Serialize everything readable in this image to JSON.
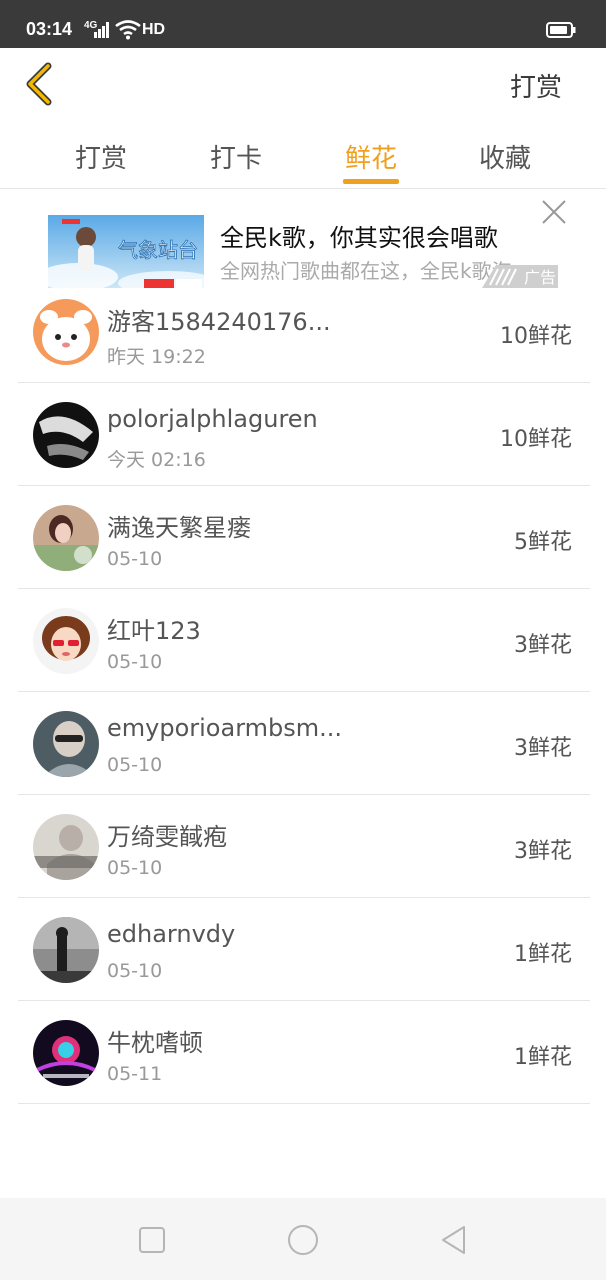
{
  "status": {
    "time": "03:14",
    "signal_label": "4G",
    "hd_label": "HD"
  },
  "header": {
    "action_label": "打赏"
  },
  "tabs": [
    {
      "label": "打赏"
    },
    {
      "label": "打卡"
    },
    {
      "label": "鲜花"
    },
    {
      "label": "收藏"
    }
  ],
  "ad": {
    "image_text": "气象站台",
    "title": "全民k歌，你其实很会唱歌",
    "description": "全网热门歌曲都在这，全民k歌海",
    "tag": "广告"
  },
  "list": [
    {
      "name": "游客1584240176...",
      "time": "昨天 19:22",
      "amount": "10鲜花"
    },
    {
      "name": "polorjalphlaguren",
      "time": "今天 02:16",
      "amount": "10鲜花"
    },
    {
      "name": "满逸天繁星瘘",
      "time": "05-10",
      "amount": "5鲜花"
    },
    {
      "name": "红叶123",
      "time": "05-10",
      "amount": "3鲜花"
    },
    {
      "name": "emyporioarmbsm...",
      "time": "05-10",
      "amount": "3鲜花"
    },
    {
      "name": "万绮雯馘疱",
      "time": "05-10",
      "amount": "3鲜花"
    },
    {
      "name": "edharnvdy",
      "time": "05-10",
      "amount": "1鲜花"
    },
    {
      "name": "牛枕嗜顿",
      "time": "05-11",
      "amount": "1鲜花"
    }
  ],
  "colors": {
    "accent": "#f0a020",
    "status_bar": "#3a3a3a"
  }
}
